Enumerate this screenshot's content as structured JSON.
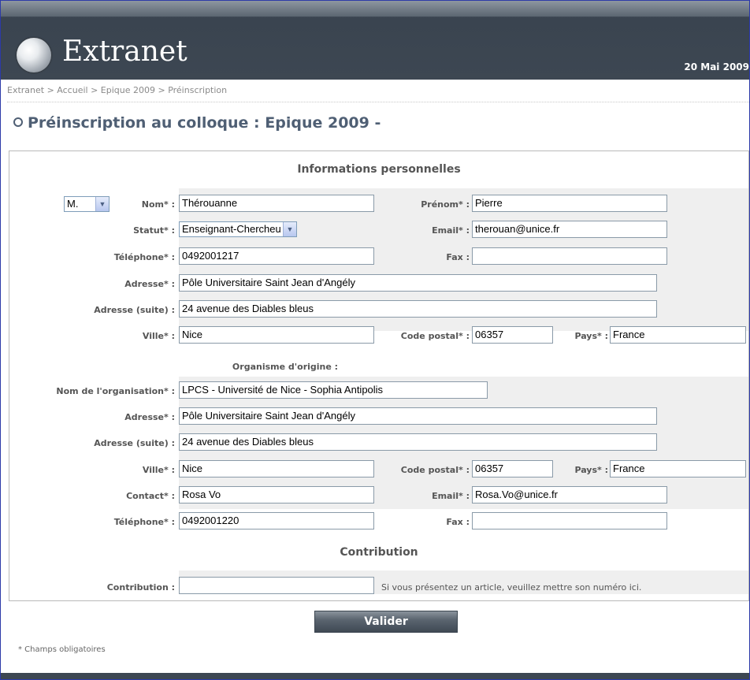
{
  "header": {
    "logo_text": "Extranet",
    "date": "20 Mai 2009"
  },
  "breadcrumb": "Extranet > Accueil > Epique 2009 > Préinscription",
  "page_title": "Préinscription au colloque : Epique 2009 -",
  "personal": {
    "section_title": "Informations personnelles",
    "civility": "M.",
    "nom_label": "Nom* :",
    "nom": "Thérouanne",
    "prenom_label": "Prénom* :",
    "prenom": "Pierre",
    "statut_label": "Statut* :",
    "statut": "Enseignant-Chercheu",
    "email_label": "Email* :",
    "email": "therouan@unice.fr",
    "telephone_label": "Téléphone* :",
    "telephone": "0492001217",
    "fax_label": "Fax :",
    "fax": "",
    "adresse_label": "Adresse* :",
    "adresse": "Pôle Universitaire Saint Jean d'Angély",
    "adresse_suite_label": "Adresse (suite) :",
    "adresse_suite": "24 avenue des Diables bleus",
    "ville_label": "Ville* :",
    "ville": "Nice",
    "code_postal_label": "Code postal* :",
    "code_postal": "06357",
    "pays_label": "Pays* :",
    "pays": "France"
  },
  "organisation": {
    "section_title": "Organisme d'origine :",
    "nom_label": "Nom de l'organisation* :",
    "nom": "LPCS - Université de Nice - Sophia Antipolis",
    "adresse_label": "Adresse* :",
    "adresse": "Pôle Universitaire Saint Jean d'Angély",
    "adresse_suite_label": "Adresse (suite) :",
    "adresse_suite": "24 avenue des Diables bleus",
    "ville_label": "Ville* :",
    "ville": "Nice",
    "code_postal_label": "Code postal* :",
    "code_postal": "06357",
    "pays_label": "Pays* :",
    "pays": "France",
    "contact_label": "Contact* :",
    "contact": "Rosa Vo",
    "email_label": "Email* :",
    "email": "Rosa.Vo@unice.fr",
    "telephone_label": "Téléphone* :",
    "telephone": "0492001220",
    "fax_label": "Fax :",
    "fax": ""
  },
  "contribution": {
    "section_title": "Contribution",
    "label": "Contribution :",
    "value": "",
    "hint": "Si vous présentez un article, veuillez mettre son numéro ici."
  },
  "submit_label": "Valider",
  "required_note": "* Champs obligatoires"
}
